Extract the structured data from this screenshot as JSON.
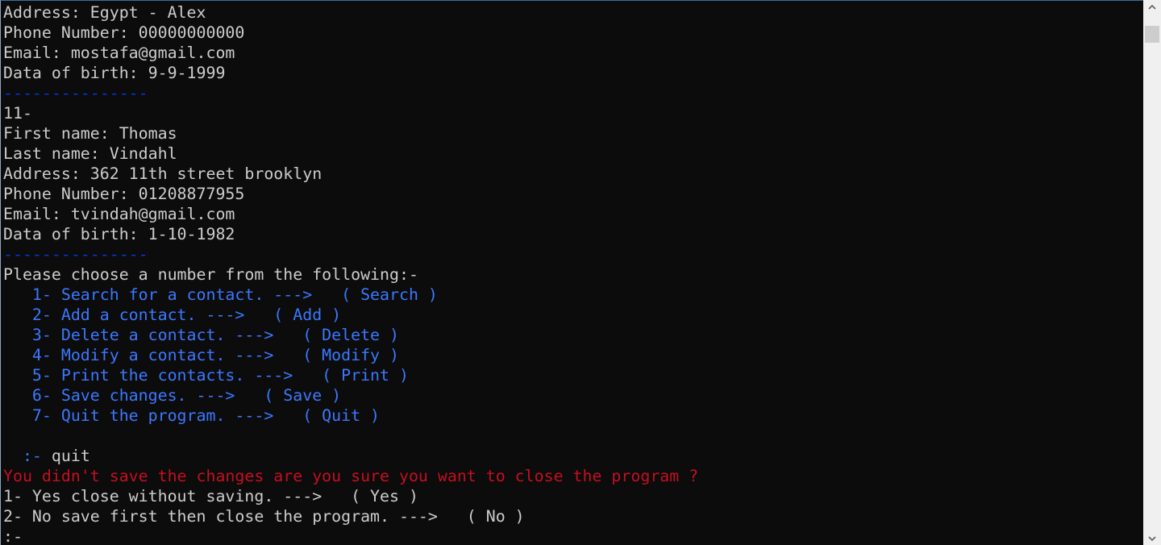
{
  "console": {
    "lines": [
      {
        "segments": [
          {
            "text": "Address: Egypt - Alex",
            "color": "white"
          }
        ]
      },
      {
        "segments": [
          {
            "text": "Phone Number: 00000000000",
            "color": "white"
          }
        ]
      },
      {
        "segments": [
          {
            "text": "Email: mostafa@gmail.com",
            "color": "white"
          }
        ]
      },
      {
        "segments": [
          {
            "text": "Data of birth: 9-9-1999",
            "color": "white"
          }
        ]
      },
      {
        "segments": [
          {
            "text": "---------------",
            "color": "dkblue"
          }
        ]
      },
      {
        "segments": [
          {
            "text": "11-",
            "color": "white"
          }
        ]
      },
      {
        "segments": [
          {
            "text": "First name: Thomas",
            "color": "white"
          }
        ]
      },
      {
        "segments": [
          {
            "text": "Last name: Vindahl",
            "color": "white"
          }
        ]
      },
      {
        "segments": [
          {
            "text": "Address: 362 11th street brooklyn",
            "color": "white"
          }
        ]
      },
      {
        "segments": [
          {
            "text": "Phone Number: 01208877955",
            "color": "white"
          }
        ]
      },
      {
        "segments": [
          {
            "text": "Email: tvindah@gmail.com",
            "color": "white"
          }
        ]
      },
      {
        "segments": [
          {
            "text": "Data of birth: 1-10-1982",
            "color": "white"
          }
        ]
      },
      {
        "segments": [
          {
            "text": "---------------",
            "color": "dkblue"
          }
        ]
      },
      {
        "segments": [
          {
            "text": "Please choose a number from the following:-",
            "color": "white"
          }
        ]
      },
      {
        "segments": [
          {
            "text": "   1- Search for a contact. --->   ( Search )",
            "color": "blue"
          }
        ]
      },
      {
        "segments": [
          {
            "text": "   2- Add a contact. --->   ( Add )",
            "color": "blue"
          }
        ]
      },
      {
        "segments": [
          {
            "text": "   3- Delete a contact. --->   ( Delete )",
            "color": "blue"
          }
        ]
      },
      {
        "segments": [
          {
            "text": "   4- Modify a contact. --->   ( Modify )",
            "color": "blue"
          }
        ]
      },
      {
        "segments": [
          {
            "text": "   5- Print the contacts. --->   ( Print )",
            "color": "blue"
          }
        ]
      },
      {
        "segments": [
          {
            "text": "   6- Save changes. --->   ( Save )",
            "color": "blue"
          }
        ]
      },
      {
        "segments": [
          {
            "text": "   7- Quit the program. --->   ( Quit )",
            "color": "blue"
          }
        ]
      },
      {
        "segments": [
          {
            "text": "",
            "color": "white"
          }
        ]
      },
      {
        "segments": [
          {
            "text": "  :- ",
            "color": "blue"
          },
          {
            "text": "quit",
            "color": "white"
          }
        ]
      },
      {
        "segments": [
          {
            "text": "You didn't save the changes are you sure you want to close the program ?",
            "color": "red"
          }
        ]
      },
      {
        "segments": [
          {
            "text": "1- Yes close without saving. --->   ( Yes )",
            "color": "white"
          }
        ]
      },
      {
        "segments": [
          {
            "text": "2- No save first then close the program. --->   ( No )",
            "color": "white"
          }
        ]
      },
      {
        "segments": [
          {
            "text": ":-",
            "color": "white"
          }
        ]
      }
    ]
  },
  "scrollbar": {
    "up_icon": "chevron-up-icon",
    "down_icon": "chevron-down-icon",
    "position_fraction": 0.02
  },
  "colors": {
    "background": "#0c0c0c",
    "white": "#cccccc",
    "blue": "#3b78ff",
    "dkblue": "#0037da",
    "red": "#c50f1f"
  }
}
